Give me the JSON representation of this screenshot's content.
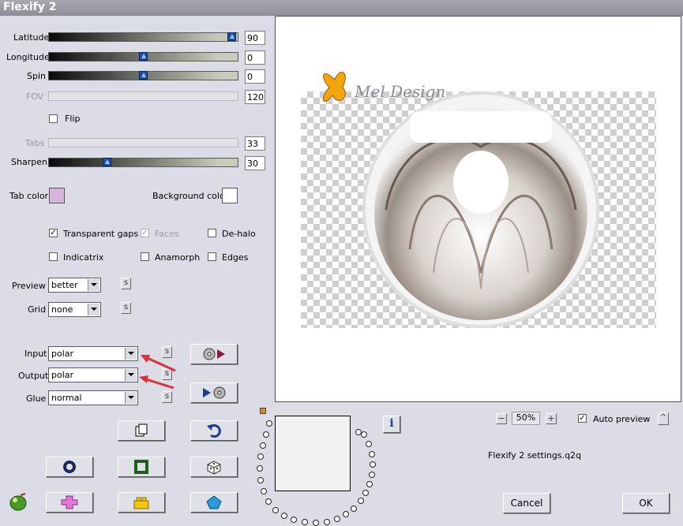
{
  "window": {
    "title": "Flexify 2"
  },
  "params": {
    "latitude": {
      "label": "Latitude",
      "value": "90",
      "fraction": 1.0
    },
    "longitude": {
      "label": "Longitude",
      "value": "0",
      "fraction": 0.5
    },
    "spin": {
      "label": "Spin",
      "value": "0",
      "fraction": 0.5
    },
    "fov": {
      "label": "FOV",
      "value": "120"
    },
    "flip": {
      "label": "Flip",
      "checked": false
    },
    "tabs": {
      "label": "Tabs",
      "value": "33"
    },
    "sharpen": {
      "label": "Sharpen",
      "value": "30",
      "fraction": 0.3
    }
  },
  "colors": {
    "tab_color": {
      "label": "Tab color",
      "value": "#d8b4dc"
    },
    "background_color": {
      "label": "Background color",
      "value": "#ffffff"
    }
  },
  "options": {
    "transparent_gaps": {
      "label": "Transparent gaps",
      "checked": true,
      "mark": "✓"
    },
    "faces": {
      "label": "Faces",
      "checked": true,
      "mark": "✓"
    },
    "de_halo": {
      "label": "De-halo",
      "checked": false
    },
    "indicatrix": {
      "label": "Indicatrix",
      "checked": false
    },
    "anamorph": {
      "label": "Anamorph",
      "checked": false
    },
    "edges": {
      "label": "Edges",
      "checked": false
    }
  },
  "selects": {
    "preview": {
      "label": "Preview",
      "value": "better"
    },
    "grid": {
      "label": "Grid",
      "value": "none"
    },
    "input": {
      "label": "Input",
      "value": "polar"
    },
    "output": {
      "label": "Output",
      "value": "polar"
    },
    "glue": {
      "label": "Glue",
      "value": "normal"
    }
  },
  "small_button_text": "s",
  "zoom": {
    "value": "50%",
    "minus": "−",
    "plus": "+"
  },
  "auto_preview": {
    "label": "Auto preview",
    "checked": true,
    "mark": "✓"
  },
  "caret_up": "^",
  "settings_file": "Flexify 2 settings.q2q",
  "info_label": "i",
  "buttons": {
    "cancel": "Cancel",
    "ok": "OK"
  },
  "watermark": "Mel Design",
  "accent": {
    "slider_thumb": "#1a4fa5",
    "arrow": "#d9303a"
  }
}
